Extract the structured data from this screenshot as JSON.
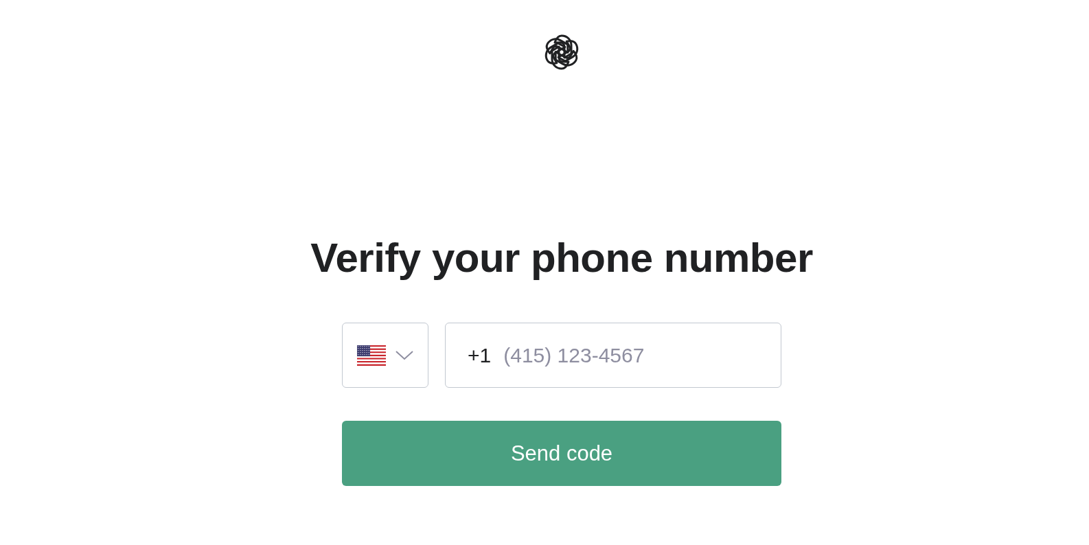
{
  "title": "Verify your phone number",
  "country_select": {
    "expanded": false
  },
  "phone": {
    "prefix": "+1",
    "placeholder": "(415) 123-4567"
  },
  "submit": {
    "label": "Send code"
  }
}
